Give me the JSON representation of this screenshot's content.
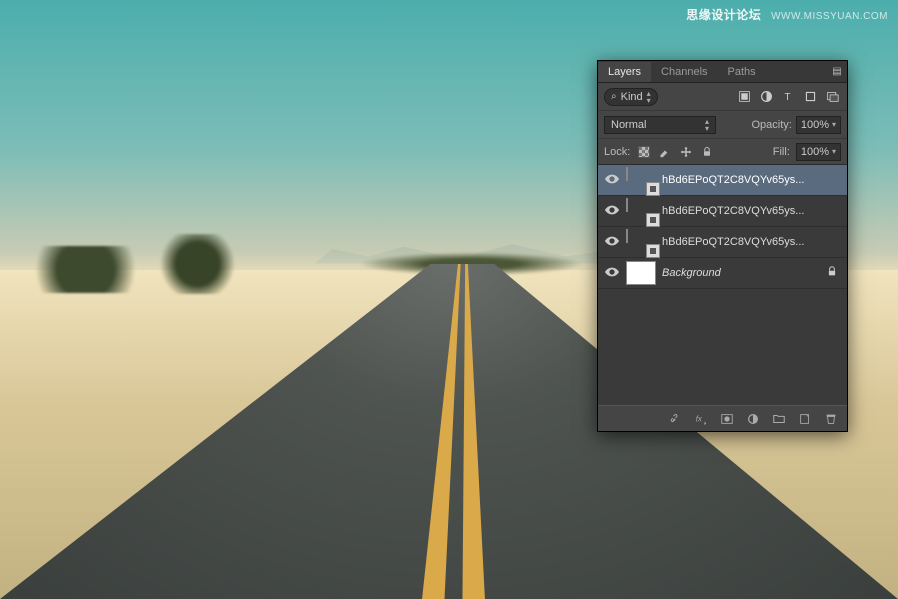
{
  "watermark": {
    "cn": "思缘设计论坛",
    "url": "WWW.MISSYUAN.COM"
  },
  "panel": {
    "tabs": {
      "layers": "Layers",
      "channels": "Channels",
      "paths": "Paths"
    },
    "filter": {
      "label": "Kind"
    },
    "blend": {
      "mode": "Normal",
      "opacity_label": "Opacity:",
      "opacity_value": "100%",
      "fill_label": "Fill:",
      "fill_value": "100%"
    },
    "lock": {
      "label": "Lock:"
    },
    "layers": [
      {
        "name": "hBd6EPoQT2C8VQYv65ys...",
        "smart": true,
        "selected": true
      },
      {
        "name": "hBd6EPoQT2C8VQYv65ys...",
        "smart": true,
        "selected": false
      },
      {
        "name": "hBd6EPoQT2C8VQYv65ys...",
        "smart": true,
        "selected": false
      },
      {
        "name": "Background",
        "smart": false,
        "selected": false,
        "locked": true,
        "bg": true
      }
    ]
  }
}
